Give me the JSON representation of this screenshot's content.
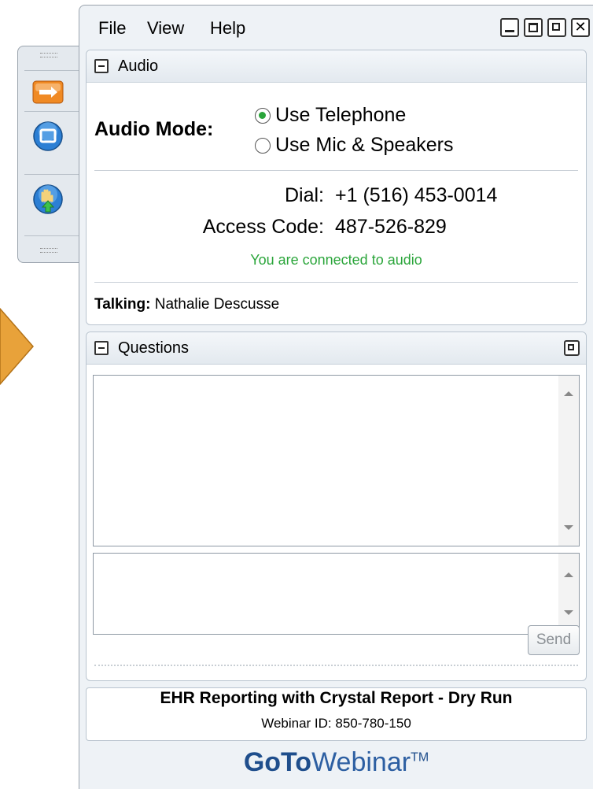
{
  "menu": {
    "file": "File",
    "view": "View",
    "help": "Help"
  },
  "window_buttons": [
    "minimize-icon",
    "maximize-icon",
    "popout-icon",
    "close-icon"
  ],
  "audio": {
    "section_title": "Audio",
    "mode_label": "Audio Mode:",
    "options": [
      {
        "label": "Use Telephone",
        "selected": true
      },
      {
        "label": "Use Mic & Speakers",
        "selected": false
      }
    ],
    "dial_label": "Dial:",
    "dial_value": "+1 (516) 453-0014",
    "access_label": "Access Code:",
    "access_value": "487-526-829",
    "status": "You are connected to audio",
    "talking_label": "Talking:",
    "talking_name": "Nathalie Descusse"
  },
  "questions": {
    "section_title": "Questions",
    "send_label": "Send"
  },
  "webinar": {
    "title": "EHR Reporting with Crystal Report - Dry Run",
    "id_text": "Webinar ID: 850-780-150"
  },
  "logo": {
    "goto": "GoTo",
    "webinar": "Webinar",
    "tm": "TM"
  },
  "colors": {
    "accent_green": "#2aa53a",
    "arrow_orange": "#e8a23a",
    "logo_blue": "#1f4e8c"
  }
}
